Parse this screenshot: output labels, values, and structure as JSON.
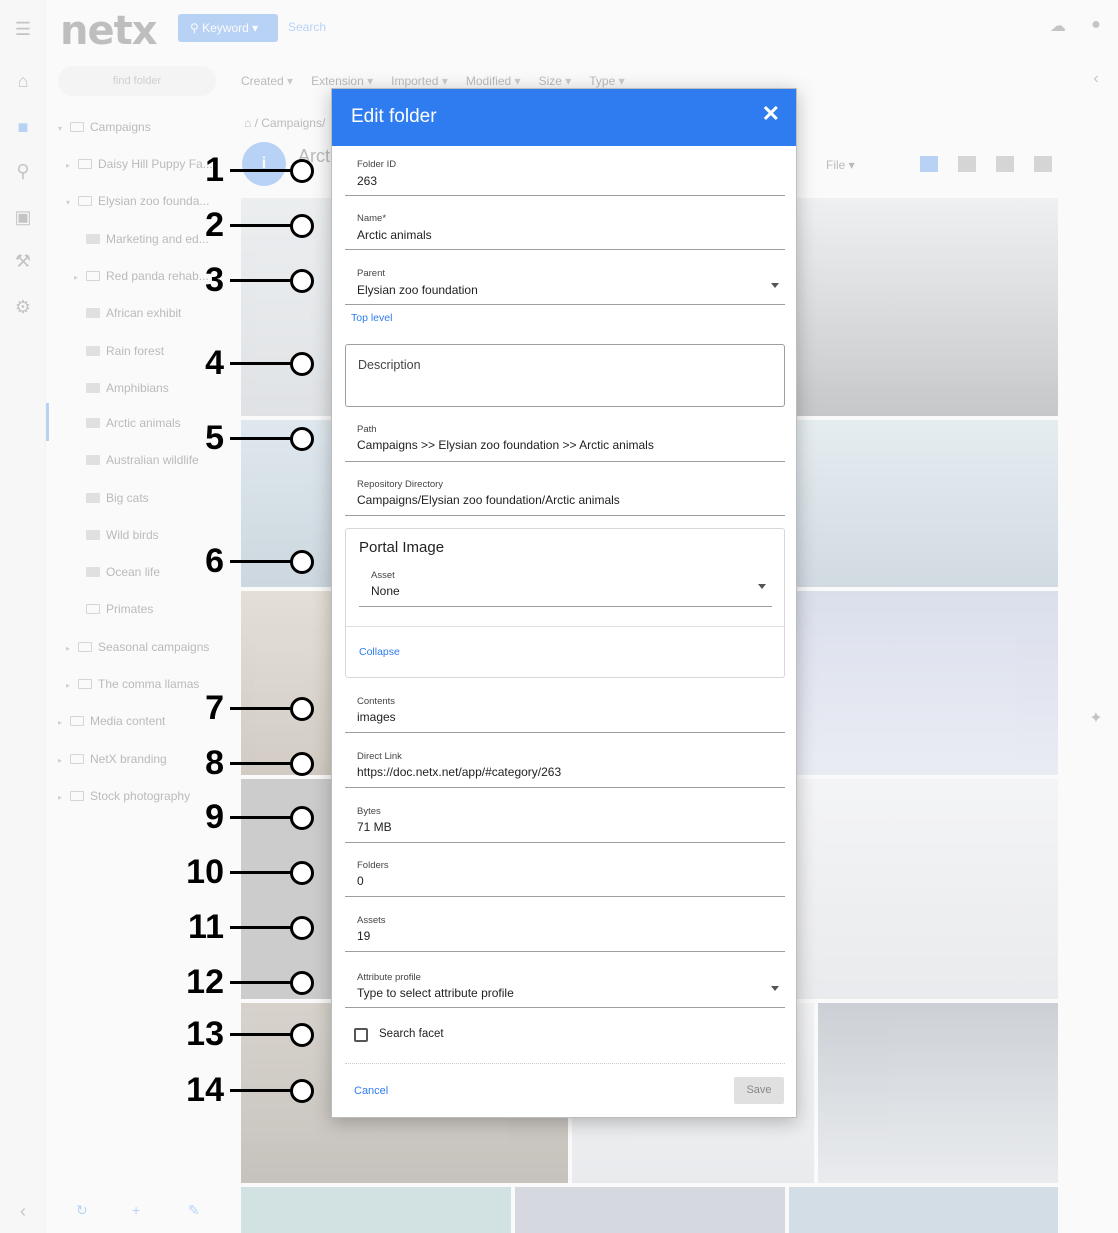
{
  "app": {
    "logo": "netx",
    "search": {
      "mode_label": "Keyword",
      "placeholder": "Search"
    },
    "find_folder_placeholder": "find folder",
    "filters": [
      "Created",
      "Extension",
      "Imported",
      "Modified",
      "Size",
      "Type"
    ],
    "breadcrumb": "/ Campaigns/",
    "folder_header_fragment": "Arct",
    "view_sort_label": "File",
    "folder_tree": [
      {
        "label": "Campaigns",
        "level": 0,
        "expanded": true
      },
      {
        "label": "Daisy Hill Puppy Fa...",
        "level": 1,
        "expanded": false
      },
      {
        "label": "Elysian zoo founda...",
        "level": 1,
        "expanded": true
      },
      {
        "label": "Marketing and ed...",
        "level": 2
      },
      {
        "label": "Red panda rehab...",
        "level": 2
      },
      {
        "label": "African exhibit",
        "level": 2
      },
      {
        "label": "Rain forest",
        "level": 2
      },
      {
        "label": "Amphibians",
        "level": 2
      },
      {
        "label": "Arctic animals",
        "level": 2,
        "selected": true
      },
      {
        "label": "Australian wildlife",
        "level": 2
      },
      {
        "label": "Big cats",
        "level": 2
      },
      {
        "label": "Wild birds",
        "level": 2
      },
      {
        "label": "Ocean life",
        "level": 2
      },
      {
        "label": "Primates",
        "level": 2
      },
      {
        "label": "Seasonal campaigns",
        "level": 1
      },
      {
        "label": "The comma llamas",
        "level": 1
      },
      {
        "label": "Media content",
        "level": 0
      },
      {
        "label": "NetX branding",
        "level": 0
      },
      {
        "label": "Stock photography",
        "level": 0
      }
    ]
  },
  "callouts": [
    "1",
    "2",
    "3",
    "4",
    "5",
    "6",
    "7",
    "8",
    "9",
    "10",
    "11",
    "12",
    "13",
    "14"
  ],
  "dialog": {
    "title": "Edit folder",
    "close_icon": "close-icon",
    "fields": {
      "folder_id": {
        "label": "Folder ID",
        "value": "263"
      },
      "name": {
        "label": "Name*",
        "value": "Arctic animals"
      },
      "parent": {
        "label": "Parent",
        "value": "Elysian zoo foundation"
      },
      "top_level_link": "Top level",
      "description": {
        "placeholder": "Description"
      },
      "path": {
        "label": "Path",
        "value": "Campaigns >> Elysian zoo foundation >> Arctic animals"
      },
      "repository_directory": {
        "label": "Repository Directory",
        "value": "Campaigns/Elysian zoo foundation/Arctic animals"
      },
      "portal_image": {
        "title": "Portal Image",
        "asset_label": "Asset",
        "asset_value": "None",
        "collapse_link": "Collapse"
      },
      "contents": {
        "label": "Contents",
        "value": "images"
      },
      "direct_link": {
        "label": "Direct Link",
        "value": "https://doc.netx.net/app/#category/263"
      },
      "bytes": {
        "label": "Bytes",
        "value": "71 MB"
      },
      "folders": {
        "label": "Folders",
        "value": "0"
      },
      "assets": {
        "label": "Assets",
        "value": "19"
      },
      "attribute_profile": {
        "label": "Attribute profile",
        "value": "Type to select attribute profile"
      },
      "search_facet": {
        "label": "Search facet",
        "checked": false
      }
    },
    "cancel_label": "Cancel",
    "save_label": "Save"
  },
  "colors": {
    "header_blue": "#2f7cf0",
    "link_blue": "#2f7cf0",
    "save_disabled": "#e0e0e0"
  }
}
